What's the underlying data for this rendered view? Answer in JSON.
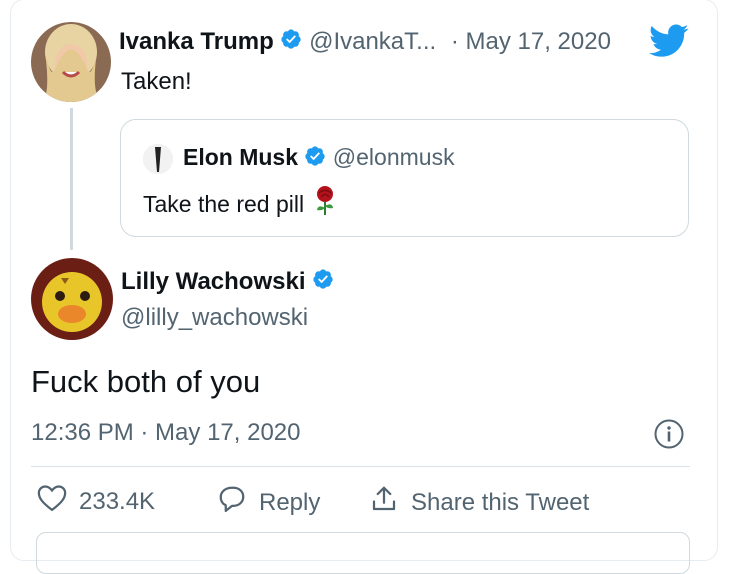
{
  "tweet_reply_to": {
    "author_name": "Ivanka Trump",
    "author_handle": "@IvankaT...",
    "separator": "·",
    "date": "May 17, 2020",
    "text": "Taken!",
    "quote": {
      "author_name": "Elon Musk",
      "author_handle": "@elonmusk",
      "text": "Take the red pill"
    }
  },
  "tweet": {
    "author_name": "Lilly Wachowski",
    "author_handle": "@lilly_wachowski",
    "text": "Fuck both of you",
    "timestamp": "12:36 PM · May 17, 2020"
  },
  "actions": {
    "likes": "233.4K",
    "reply_label": "Reply",
    "share_label": "Share this Tweet"
  },
  "colors": {
    "twitter_blue": "#1d9bf0",
    "text": "#0f1419",
    "muted": "#536471",
    "border": "#cfd9de"
  },
  "icons": [
    "twitter-bird-icon",
    "verified-badge-icon",
    "info-icon",
    "heart-icon",
    "reply-icon",
    "share-icon",
    "rose-emoji-icon"
  ]
}
